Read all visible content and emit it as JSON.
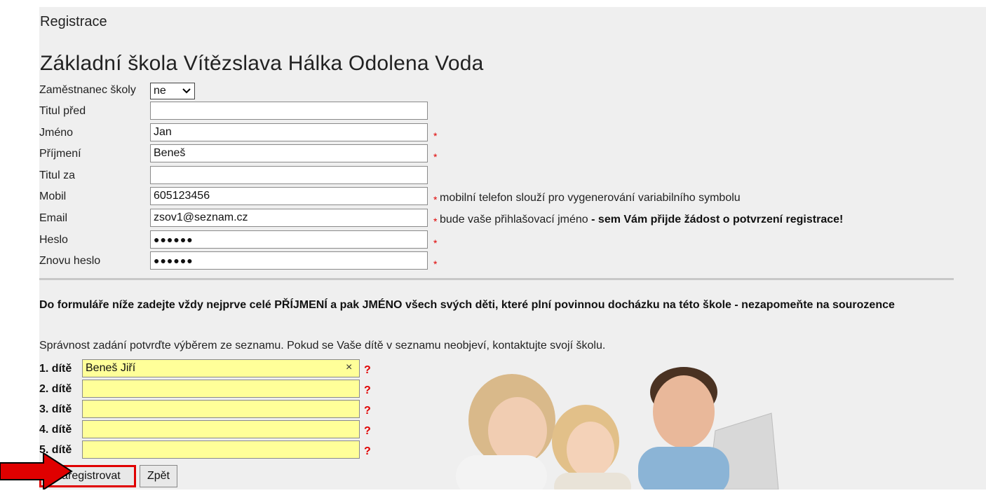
{
  "breadcrumb": "Registrace",
  "school_name": "Základní škola Vítězslava Hálka Odolena Voda",
  "employee": {
    "label": "Zaměstnanec školy",
    "selected": "ne"
  },
  "fields": {
    "title_before": {
      "label": "Titul před",
      "value": ""
    },
    "first_name": {
      "label": "Jméno",
      "value": "Jan"
    },
    "last_name": {
      "label": "Příjmení",
      "value": "Beneš"
    },
    "title_after": {
      "label": "Titul za",
      "value": ""
    },
    "mobile": {
      "label": "Mobil",
      "value": "605123456",
      "note": "mobilní telefon slouží pro vygenerování variabilního symbolu"
    },
    "email": {
      "label": "Email",
      "value": "zsov1@seznam.cz",
      "note_plain": "bude vaše přihlašovací jméno",
      "note_bold": "- sem Vám přijde žádost o potvrzení registrace!"
    },
    "password": {
      "label": "Heslo",
      "value": "●●●●●●"
    },
    "password_again": {
      "label": "Znovu heslo",
      "value": "●●●●●●"
    }
  },
  "required_mark": "*",
  "instructions": {
    "bold": "Do formuláře níže zadejte vždy nejprve celé PŘÍJMENÍ a pak JMÉNO všech svých děti, které plní povinnou docházku na této škole - nezapomeňte na sourozence",
    "normal": "Správnost zadání potvrďte výběrem ze seznamu. Pokud se Vaše dítě v seznamu neobjeví, kontaktujte svojí školu."
  },
  "children": [
    {
      "label": "1. dítě",
      "value": "Beneš Jiří",
      "clear": "×",
      "help": "?"
    },
    {
      "label": "2. dítě",
      "value": "",
      "help": "?"
    },
    {
      "label": "3. dítě",
      "value": "",
      "help": "?"
    },
    {
      "label": "4. dítě",
      "value": "",
      "help": "?"
    },
    {
      "label": "5. dítě",
      "value": "",
      "help": "?"
    }
  ],
  "buttons": {
    "register": "Zaregistrovat",
    "back": "Zpět"
  },
  "colors": {
    "highlight": "#ffff99",
    "required": "#e00000",
    "arrow": "#e00000"
  }
}
